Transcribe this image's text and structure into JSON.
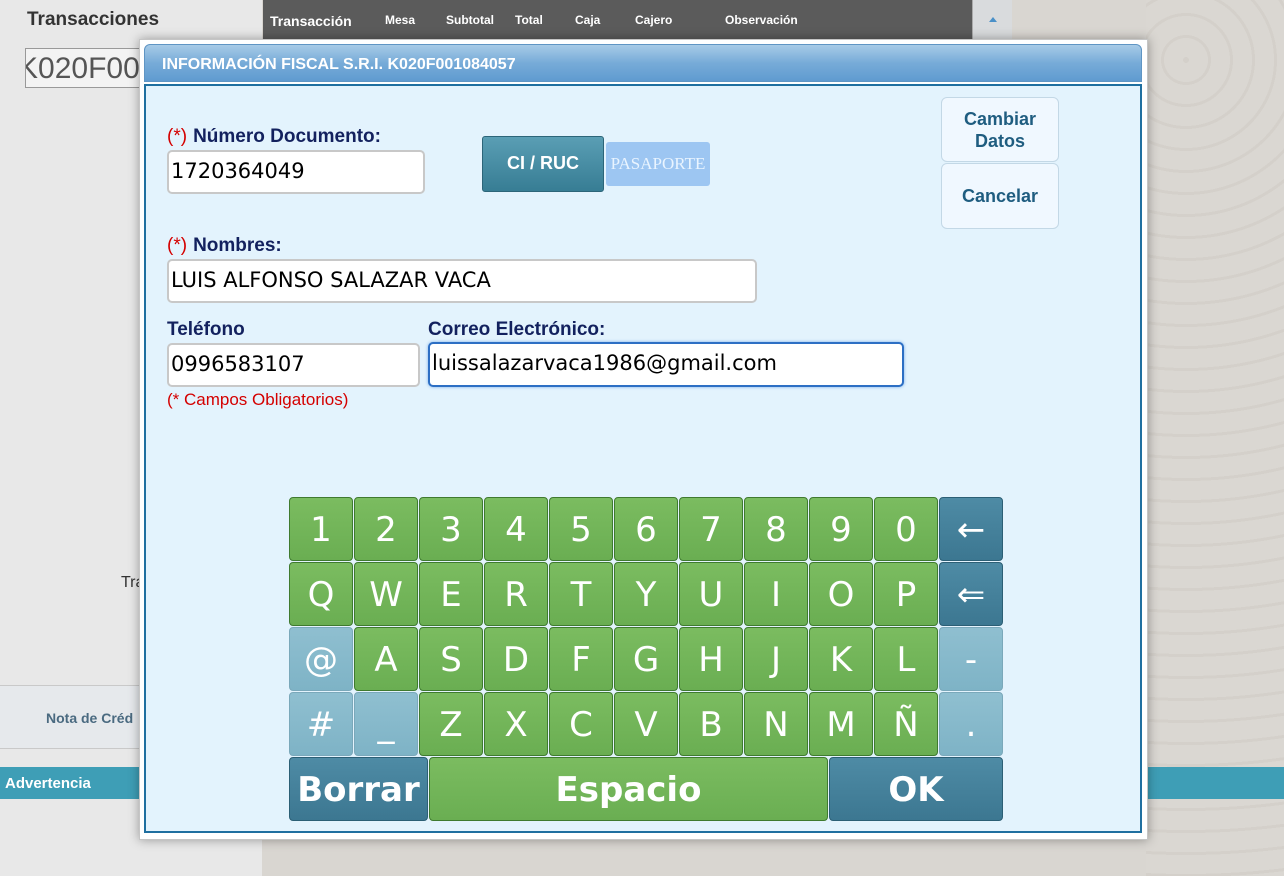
{
  "background": {
    "section_title": "Transacciones",
    "code_field": "K020F00",
    "partial_label": "Tra",
    "note_button": "Nota de Créd",
    "warning_bar": "Advertencia",
    "table_headers": [
      "Transacción",
      "Mesa",
      "Subtotal",
      "Total",
      "Caja",
      "Cajero",
      "Observación"
    ]
  },
  "modal": {
    "title": "INFORMACIÓN FISCAL S.R.I. K020F001084057",
    "required_marker": "(*)",
    "doc_label": "Número Documento:",
    "doc_value": "1720364049",
    "ci_ruc_button": "CI / RUC",
    "pasaporte_button": "PASAPORTE",
    "change_data_button_line1": "Cambiar",
    "change_data_button_line2": "Datos",
    "cancel_button": "Cancelar",
    "names_label": "Nombres:",
    "names_value": "LUIS ALFONSO SALAZAR VACA",
    "phone_label": "Teléfono",
    "phone_value": "0996583107",
    "email_label": "Correo Electrónico:",
    "email_value": "luissalazarvaca1986@gmail.com",
    "required_note": "(* Campos Obligatorios)"
  },
  "keyboard": {
    "rows": [
      [
        "1",
        "2",
        "3",
        "4",
        "5",
        "6",
        "7",
        "8",
        "9",
        "0",
        "←"
      ],
      [
        "Q",
        "W",
        "E",
        "R",
        "T",
        "Y",
        "U",
        "I",
        "O",
        "P",
        "⇐"
      ],
      [
        "@",
        "A",
        "S",
        "D",
        "F",
        "G",
        "H",
        "J",
        "K",
        "L",
        "-"
      ],
      [
        "#",
        "_",
        "Z",
        "X",
        "C",
        "V",
        "B",
        "N",
        "M",
        "Ñ",
        "."
      ]
    ],
    "borrar": "Borrar",
    "espacio": "Espacio",
    "ok": "OK"
  }
}
